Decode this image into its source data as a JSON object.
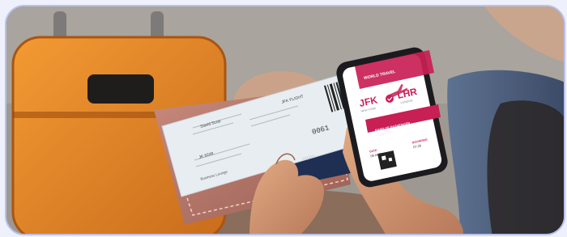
{
  "image": {
    "alt_subject": "traveler-holding-boarding-pass-and-mobile-boarding-pass",
    "palette": {
      "suitcase": "#e88a2a",
      "wallet": "#b9776a",
      "ticket": "#e8edf1",
      "phone_accent": "#c81f55",
      "border": "#b9c1ea"
    }
  },
  "paper_ticket": {
    "name_line": "David Scott",
    "flight_number": "JFK FLIGHT",
    "seat_number": "0061",
    "section_1": "JK 8248",
    "section_2": "Business Lounge",
    "passport_label": "ssport"
  },
  "mobile_pass": {
    "header_small": "WORLD TRAVEL",
    "origin": "JFK",
    "destination": "LHR",
    "origin_city": "NEW YORK",
    "destination_city": "LONDON",
    "banner_text": "BAND OF PASSENGER",
    "banner_sub": "DAVID SCOTT",
    "field_left_label": "DATE",
    "field_left_value": "09 AUG",
    "field_right_label": "BOARDING",
    "field_right_value": "07:20"
  }
}
